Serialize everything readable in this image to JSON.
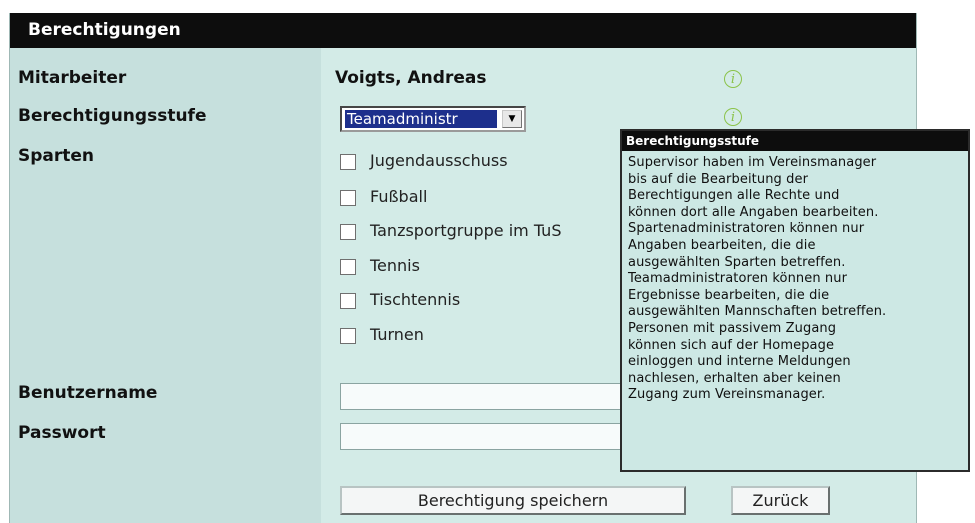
{
  "panel": {
    "title": "Berechtigungen"
  },
  "form": {
    "mitarbeiter_label": "Mitarbeiter",
    "mitarbeiter_value": "Voigts, Andreas",
    "stufe_label": "Berechtigungsstufe",
    "stufe_value": "Teamadministr",
    "sparten_label": "Sparten",
    "sparten": [
      {
        "label": "Jugendausschuss",
        "checked": false
      },
      {
        "label": "Fußball",
        "checked": false
      },
      {
        "label": "Tanzsportgruppe im TuS",
        "checked": false
      },
      {
        "label": "Tennis",
        "checked": false
      },
      {
        "label": "Tischtennis",
        "checked": false
      },
      {
        "label": "Turnen",
        "checked": false
      }
    ],
    "benutzername_label": "Benutzername",
    "benutzername_value": "",
    "passwort_label": "Passwort",
    "passwort_value": ""
  },
  "buttons": {
    "save": "Berechtigung speichern",
    "back": "Zurück"
  },
  "info_icon": "info-icon",
  "tooltip": {
    "title": "Berechtigungsstufe",
    "lines": [
      "Supervisor haben im Vereinsmanager",
      "bis auf die Bearbeitung der",
      "Berechtigungen alle Rechte und",
      "können dort alle Angaben bearbeiten.",
      "Spartenadministratoren können nur",
      "Angaben bearbeiten, die die",
      "ausgewählten Sparten betreffen.",
      "Teamadministratoren können nur",
      "Ergebnisse bearbeiten, die die",
      "ausgewählten Mannschaften betreffen.",
      "Personen mit passivem Zugang",
      "können sich auf der Homepage",
      "einloggen und interne Meldungen",
      "nachlesen, erhalten aber keinen",
      "Zugang zum Vereinsmanager."
    ]
  },
  "colors": {
    "header_bg": "#0d0d0d",
    "panel_bg": "#d3ebe7",
    "info_icon": "#8bc34a",
    "selection": "#1d2f8c"
  }
}
